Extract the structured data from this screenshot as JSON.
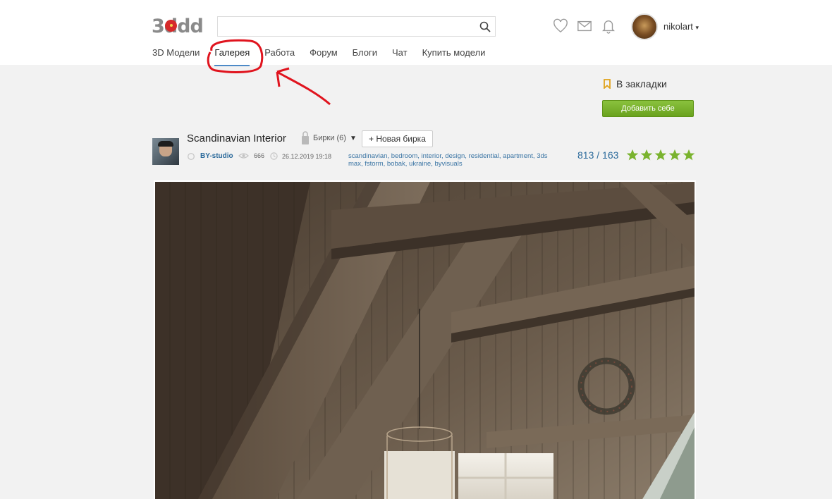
{
  "header": {
    "logo_text": "3ddd",
    "search": {
      "placeholder": "",
      "value": ""
    },
    "username": "nikolart",
    "icons": [
      "heart-icon",
      "mail-icon",
      "bell-icon",
      "search-icon"
    ]
  },
  "nav": {
    "items": [
      {
        "label": "3D Модели",
        "active": false
      },
      {
        "label": "Галерея",
        "active": true
      },
      {
        "label": "Работа",
        "active": false
      },
      {
        "label": "Форум",
        "active": false
      },
      {
        "label": "Блоги",
        "active": false
      },
      {
        "label": "Чат",
        "active": false
      },
      {
        "label": "Купить модели",
        "active": false
      }
    ]
  },
  "bookmark": {
    "label": "В закладки",
    "add_button": "Добавить себе"
  },
  "work": {
    "title": "Scandinavian Interior",
    "tags_control": "Бирки (6)",
    "new_tag_button": "+ Новая бирка",
    "author": "BY-studio",
    "views": "666",
    "date": "26.12.2019 19:18",
    "tags": "scandinavian, bedroom, interior, design, residential, apartment, 3ds max, fstorm, bobak, ukraine, byvisuals",
    "rating": "813 / 163",
    "stars": 5
  },
  "colors": {
    "accent_green": "#7ab32e",
    "link_blue": "#2b6a9b",
    "star_green": "#7ab32e",
    "annotation_red": "#e0141e"
  }
}
